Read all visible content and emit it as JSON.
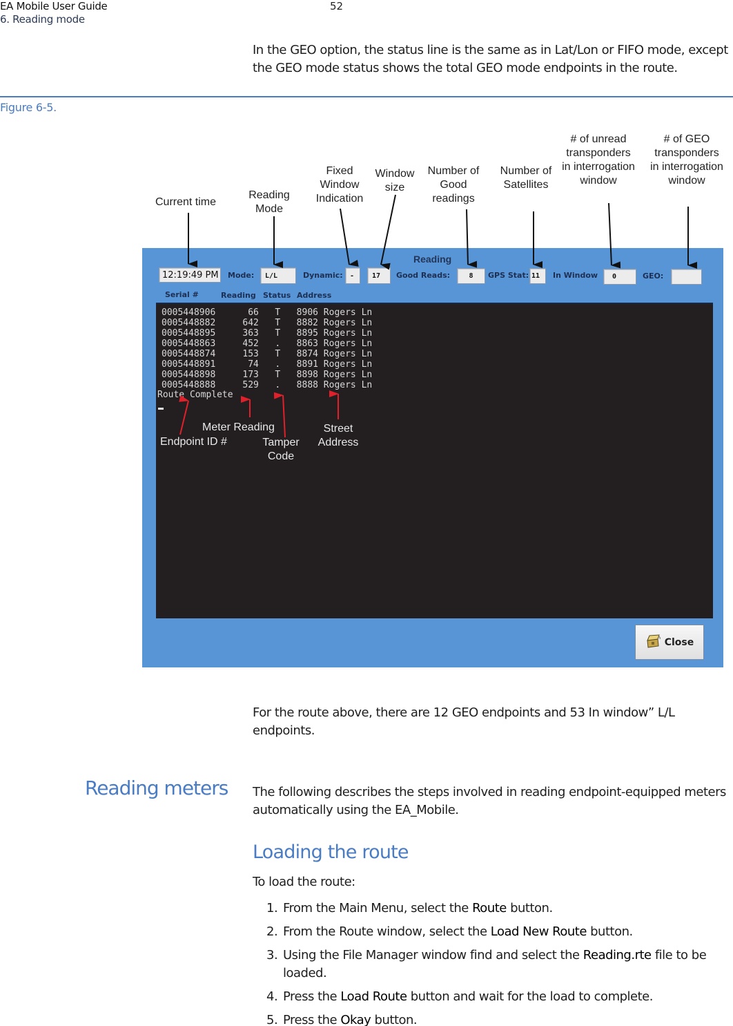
{
  "header": {
    "doc_title": "EA Mobile User Guide",
    "section": "6. Reading mode",
    "page_number": "52"
  },
  "intro_text": "In the GEO option, the status line is the same as in Lat/Lon or FIFO mode, except the GEO mode status shows the total GEO mode endpoints in the route.",
  "figure": {
    "label": "Figure 6-5.",
    "callouts_top": {
      "current_time": "Current time",
      "reading_mode": "Reading Mode",
      "fixed_window": "Fixed Window Indication",
      "window_size": "Window size",
      "good_readings": "Number of Good readings",
      "satellites": "Number of Satellites",
      "unread": "# of unread transponders in interrogation window",
      "geo": "# of GEO transponders in interrogation window"
    },
    "callouts_console": {
      "endpoint_id": "Endpoint ID #",
      "meter_reading": "Meter Reading",
      "tamper_code": "Tamper Code",
      "street_address": "Street Address"
    },
    "app": {
      "title": "Reading",
      "time": "12:19:49 PM",
      "mode_label": "Mode:",
      "mode_value": "L/L",
      "dynamic_label": "Dynamic:",
      "dynamic_value": "-",
      "window_size_value": "17",
      "good_reads_label": "Good Reads:",
      "good_reads_value": "8",
      "gps_label": "GPS Stat:",
      "gps_value": "11",
      "in_window_label": "In Window",
      "in_window_value": "0",
      "geo_label": "GEO:",
      "geo_value": "",
      "columns": [
        "Serial #",
        "Reading",
        "Status",
        "Address"
      ],
      "rows": [
        {
          "serial": "0005448906",
          "reading": "66",
          "status": "T",
          "address": "8906 Rogers Ln"
        },
        {
          "serial": "0005448882",
          "reading": "642",
          "status": "T",
          "address": "8882 Rogers Ln"
        },
        {
          "serial": "0005448895",
          "reading": "363",
          "status": "T",
          "address": "8895 Rogers Ln"
        },
        {
          "serial": "0005448863",
          "reading": "452",
          "status": ".",
          "address": "8863 Rogers Ln"
        },
        {
          "serial": "0005448874",
          "reading": "153",
          "status": "T",
          "address": "8874 Rogers Ln"
        },
        {
          "serial": "0005448891",
          "reading": "74",
          "status": ".",
          "address": "8891 Rogers Ln"
        },
        {
          "serial": "0005448898",
          "reading": "173",
          "status": "T",
          "address": "8898 Rogers Ln"
        },
        {
          "serial": "0005448888",
          "reading": "529",
          "status": ".",
          "address": "8888 Rogers Ln"
        }
      ],
      "route_status": "Route Complete",
      "close_label": "Close"
    }
  },
  "after_figure_text": "For the route above, there are 12 GEO endpoints and 53 In window” L/L endpoints.",
  "reading_meters": {
    "heading": "Reading meters",
    "text": "The following describes the steps involved in reading endpoint-equipped meters automatically using the EA_Mobile."
  },
  "loading_route": {
    "heading": "Loading the route",
    "intro": "To load the route:",
    "steps": [
      {
        "num": "1.",
        "pre": "From the Main Menu, select the ",
        "bold": "Route",
        "post": " button."
      },
      {
        "num": "2.",
        "pre": "From the Route window, select the ",
        "bold": "Load New Route",
        "post": " button."
      },
      {
        "num": "3.",
        "pre": "Using the File Manager window find and select the ",
        "bold": "Reading.rte",
        "post": " file to be loaded."
      },
      {
        "num": "4.",
        "pre": "Press the ",
        "bold": "Load Route",
        "post": " button and wait for the load to complete."
      },
      {
        "num": "5.",
        "pre": "Press the ",
        "bold": "Okay",
        "post": " button."
      }
    ]
  }
}
